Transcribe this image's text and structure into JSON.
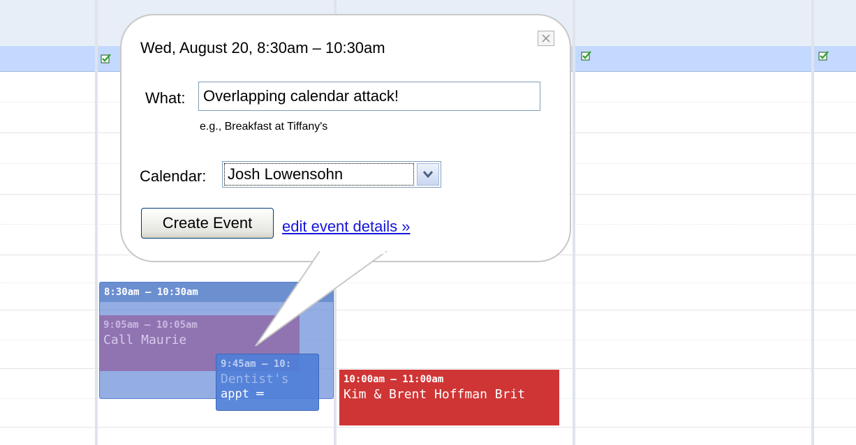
{
  "allday_checks": [
    "check-icon",
    "check-icon",
    "check-icon"
  ],
  "events": {
    "selected": {
      "time": "8:30am – 10:30am"
    },
    "call": {
      "time": "9:05am – 10:05am",
      "title": "Call Maurie"
    },
    "dentist": {
      "time": "9:45am – 10:",
      "title": "Dentist's",
      "title2": "appt",
      "handle": "resize-handle-icon"
    },
    "kim": {
      "time": "10:00am – 11:00am",
      "title": "Kim & Brent Hoffman Brit"
    }
  },
  "popup": {
    "date": "Wed, August 20, 8:30am – 10:30am",
    "what_label": "What:",
    "what_value": "Overlapping calendar attack!",
    "example": "e.g., Breakfast at Tiffany's",
    "calendar_label": "Calendar:",
    "calendar_value": "Josh Lowensohn",
    "create_button": "Create Event",
    "edit_link": "edit event details »",
    "close_icon": "close-icon"
  },
  "colors": {
    "allday_bar": "#c3d9ff",
    "selected_event": "#668cd9",
    "call_event": "#8e6aa8",
    "dentist_event": "#4f7fd8",
    "kim_event": "#d03535"
  }
}
